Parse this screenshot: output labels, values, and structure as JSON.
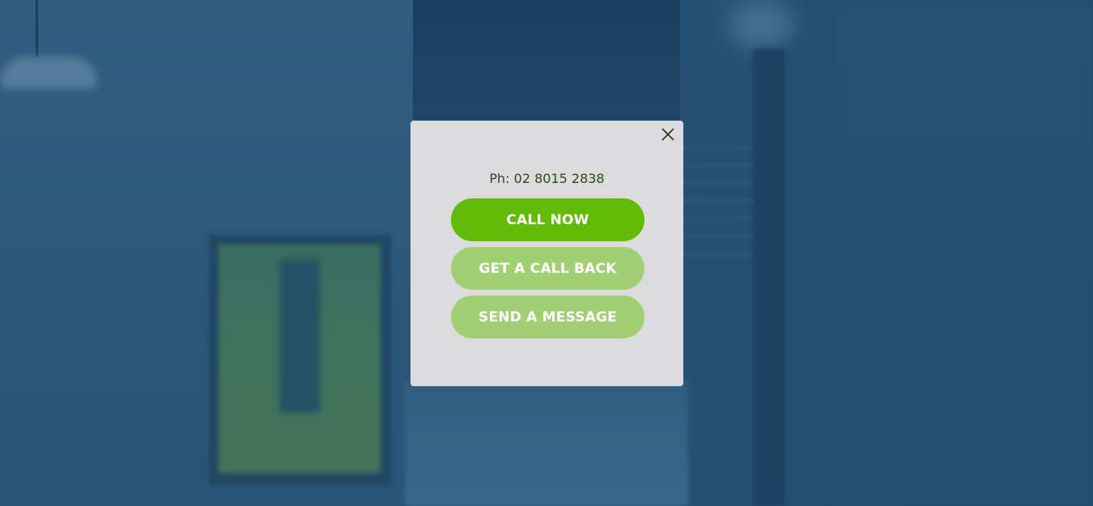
{
  "colors": {
    "accent": "#62bb06",
    "accent_light": "#a2cf74",
    "modal_bg": "#dcdcde",
    "text_dark_green": "#2b4a14"
  },
  "modal": {
    "close_icon": "close-icon",
    "phone_text": "Ph: 02 8015 2838",
    "buttons": {
      "call_now": "CALL NOW",
      "get_call_back": "GET A CALL BACK",
      "send_message": "SEND A MESSAGE"
    }
  }
}
